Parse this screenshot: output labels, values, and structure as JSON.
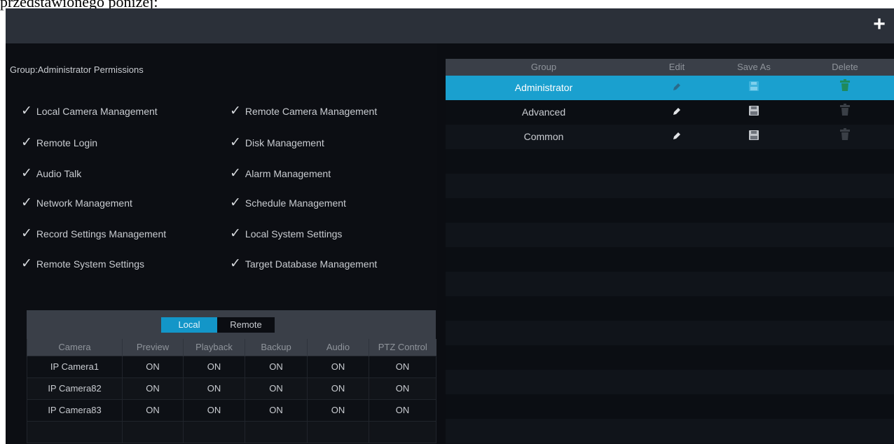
{
  "caption": "przedstawionego poniżej:",
  "topbar": {
    "add_label": "+"
  },
  "permissions": {
    "title": "Group:Administrator Permissions",
    "check_symbol": "✓",
    "left_column": [
      "Local Camera Management",
      "Remote Login",
      "Audio Talk",
      "Network Management",
      "Record Settings Management",
      "Remote System Settings"
    ],
    "right_column": [
      "Remote Camera Management",
      "Disk Management",
      "Alarm Management",
      "Schedule Management",
      "Local System Settings",
      "Target Database Management"
    ]
  },
  "tabs": {
    "local": "Local",
    "remote": "Remote",
    "active": "local"
  },
  "camera_table": {
    "headers": [
      "Camera",
      "Preview",
      "Playback",
      "Backup",
      "Audio",
      "PTZ Control"
    ],
    "rows": [
      [
        "IP Camera1",
        "ON",
        "ON",
        "ON",
        "ON",
        "ON"
      ],
      [
        "IP Camera82",
        "ON",
        "ON",
        "ON",
        "ON",
        "ON"
      ],
      [
        "IP Camera83",
        "ON",
        "ON",
        "ON",
        "ON",
        "ON"
      ]
    ]
  },
  "group_table": {
    "headers": {
      "group": "Group",
      "edit": "Edit",
      "save_as": "Save As",
      "delete": "Delete"
    },
    "rows": [
      {
        "name": "Administrator",
        "selected": true
      },
      {
        "name": "Advanced",
        "selected": false
      },
      {
        "name": "Common",
        "selected": false
      }
    ]
  },
  "icons": {
    "edit": "pencil-icon",
    "save_as": "floppy-disk-icon",
    "delete": "trash-icon",
    "add": "plus-icon",
    "check": "checkmark-icon"
  },
  "colors": {
    "accent": "#1aa0cf",
    "tab_active": "#1396c8",
    "header_bg": "#3a3f48",
    "topbar_bg": "#2b3039",
    "panel_bg": "#0b0d12",
    "delete_active": "#1f8a5c",
    "icon_disabled": "#3a3f46"
  }
}
